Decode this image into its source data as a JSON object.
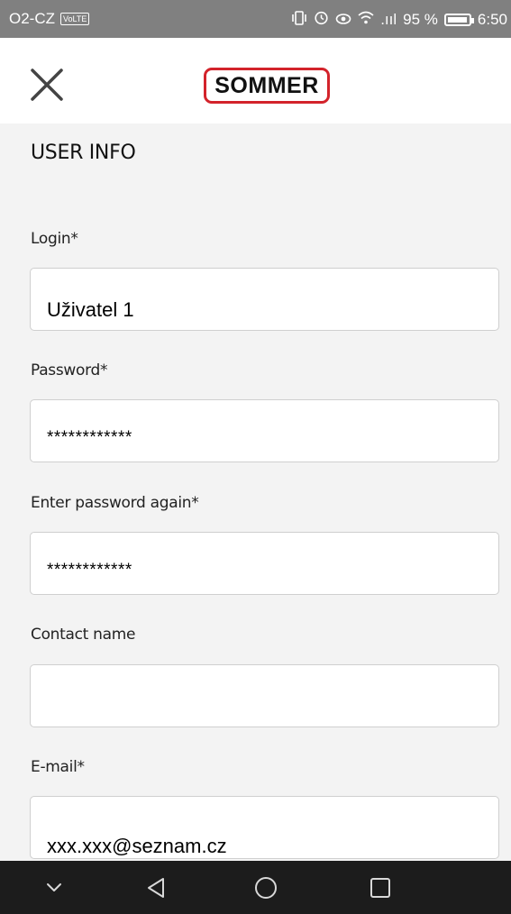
{
  "status_bar": {
    "carrier": "O2-CZ",
    "network_badge": "VoLTE",
    "signal_text": ".ııl",
    "battery_percent": "95 %",
    "time": "6:50",
    "icons": [
      "vibrate-icon",
      "alarm-icon",
      "eye-comfort-icon",
      "wifi-icon",
      "signal-icon",
      "battery-icon"
    ]
  },
  "app_bar": {
    "close_icon": "close-icon",
    "logo_text": "SOMMER",
    "logo_color": "#d3232b"
  },
  "form": {
    "title": "USER INFO",
    "fields": [
      {
        "label": "Login*",
        "value": "Uživatel 1"
      },
      {
        "label": "Password*",
        "value": "************"
      },
      {
        "label": "Enter password again*",
        "value": "************"
      },
      {
        "label": "Contact name",
        "value": ""
      },
      {
        "label": "E-mail*",
        "value": "xxx.xxx@seznam.cz"
      }
    ]
  },
  "nav_bar": {
    "icons": [
      "chevron-down-icon",
      "back-icon",
      "home-icon",
      "recents-icon"
    ]
  }
}
